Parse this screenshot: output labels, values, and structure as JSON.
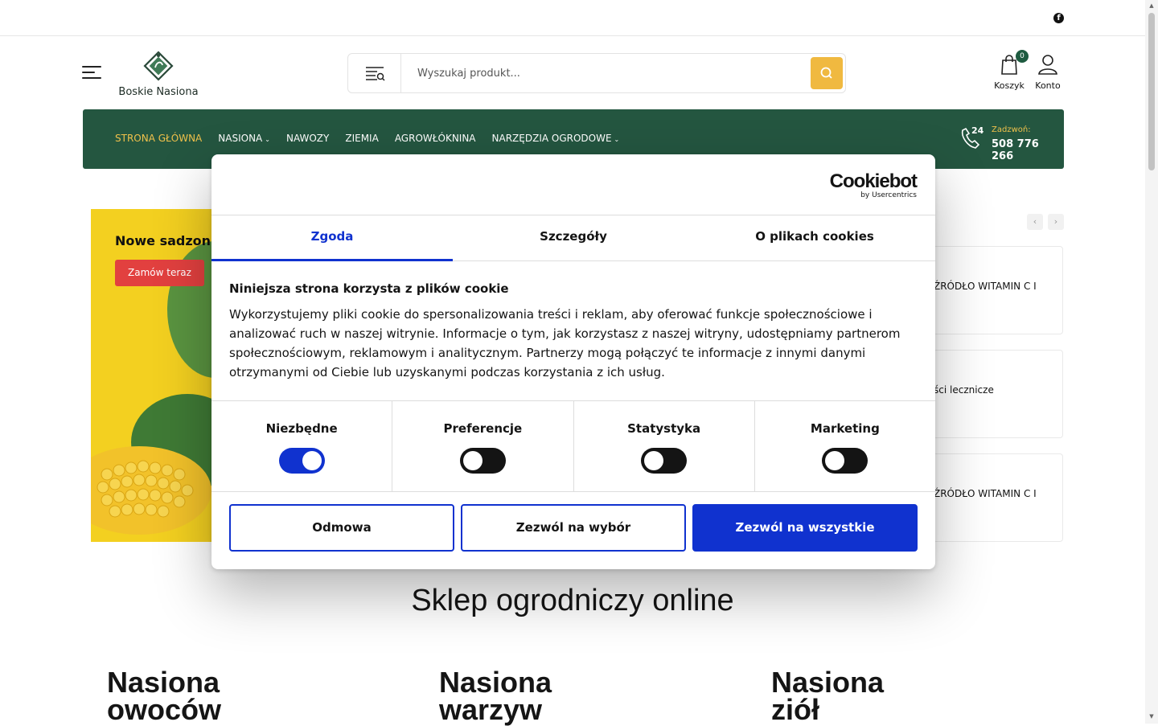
{
  "header": {
    "logo_text": "Boskie Nasiona",
    "search_placeholder": "Wyszukaj produkt...",
    "cart_label": "Koszyk",
    "cart_count": "0",
    "account_label": "Konto",
    "facebook_icon": "f"
  },
  "nav": {
    "items": [
      {
        "label": "STRONA GŁÓWNA",
        "active": true
      },
      {
        "label": "NASIONA",
        "dropdown": true
      },
      {
        "label": "NAWOZY"
      },
      {
        "label": "ZIEMIA"
      },
      {
        "label": "AGROWŁÓKNINA"
      },
      {
        "label": "NARZĘDZIA OGRODOWE",
        "dropdown": true
      }
    ],
    "call_label": "Zadzwoń:",
    "phone": "508 776 266",
    "phone_badge": "24"
  },
  "banner": {
    "title": "Nowe sadzonki",
    "button": "Zamów teraz"
  },
  "products": [
    {
      "label": "ŹRÓDŁO WITAMIN C I"
    },
    {
      "label": "ści lecznicze"
    },
    {
      "label": "ŹRÓDŁO WITAMIN C I"
    }
  ],
  "section_title": "Sklep ogrodniczy online",
  "categories": [
    {
      "line1": "Nasiona",
      "line2": "owoców"
    },
    {
      "line1": "Nasiona",
      "line2": "warzyw"
    },
    {
      "line1": "Nasiona",
      "line2": "ziół"
    }
  ],
  "cookie": {
    "brand": "Cookiebot",
    "brand_sub": "by Usercentrics",
    "tabs": [
      "Zgoda",
      "Szczegóły",
      "O plikach cookies"
    ],
    "heading": "Niniejsza strona korzysta z plików cookie",
    "body": "Wykorzystujemy pliki cookie do spersonalizowania treści i reklam, aby oferować funkcje społecznościowe i analizować ruch w naszej witrynie. Informacje o tym, jak korzystasz z naszej witryny, udostępniamy partnerom społecznościowym, reklamowym i analitycznym. Partnerzy mogą połączyć te informacje z innymi danymi otrzymanymi od Ciebie lub uzyskanymi podczas korzystania z ich usług.",
    "toggles": [
      {
        "label": "Niezbędne",
        "on": true
      },
      {
        "label": "Preferencje",
        "on": false
      },
      {
        "label": "Statystyka",
        "on": false
      },
      {
        "label": "Marketing",
        "on": false
      }
    ],
    "buttons": {
      "deny": "Odmowa",
      "allow_selection": "Zezwól na wybór",
      "allow_all": "Zezwól na wszystkie"
    },
    "accent_color": "#1032cf"
  },
  "colors": {
    "nav_bg": "#245640",
    "nav_active": "#f0c14b",
    "search_button": "#f0b940",
    "banner_bg": "#f3d020",
    "order_button": "#e2403f"
  }
}
